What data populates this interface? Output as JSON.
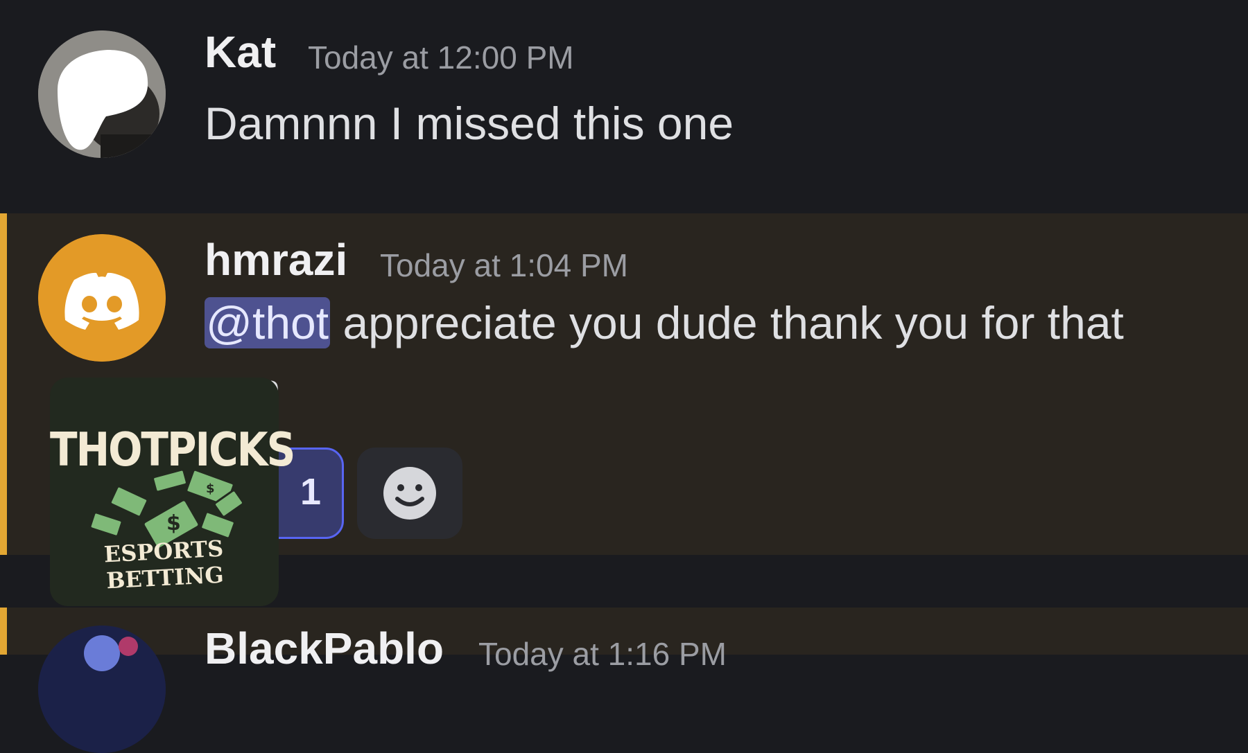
{
  "messages": [
    {
      "author": "Kat",
      "timestamp": "Today at 12:00 PM",
      "text": "Damnnn I missed this one",
      "avatar": "user-photo"
    },
    {
      "author": "hmrazi",
      "timestamp": "Today at 1:04 PM",
      "mention": "@thot",
      "text_line1": "appreciate you dude thank you for that",
      "text_line2": "nan",
      "avatar": "discord-default-logo",
      "mention_highlight": true,
      "reactions": [
        {
          "emoji": "red-emoji",
          "count": "1",
          "active": true
        }
      ],
      "add_reaction_icon": "smiley-add-reaction-icon"
    },
    {
      "author": "BlackPablo",
      "timestamp": "Today at 1:16 PM",
      "avatar": "user-photo"
    }
  ],
  "watermark": {
    "top": "THOTPICKS",
    "bottom": "ESPORTS BETTING",
    "icon": "money-bills-icon"
  },
  "colors": {
    "background": "#1a1b1f",
    "mention_background": "#29251f",
    "mention_bar": "#e3a733",
    "mention_pill": "#4e5290",
    "reaction_active_border": "#5865f2",
    "discord_avatar": "#e39a27"
  }
}
